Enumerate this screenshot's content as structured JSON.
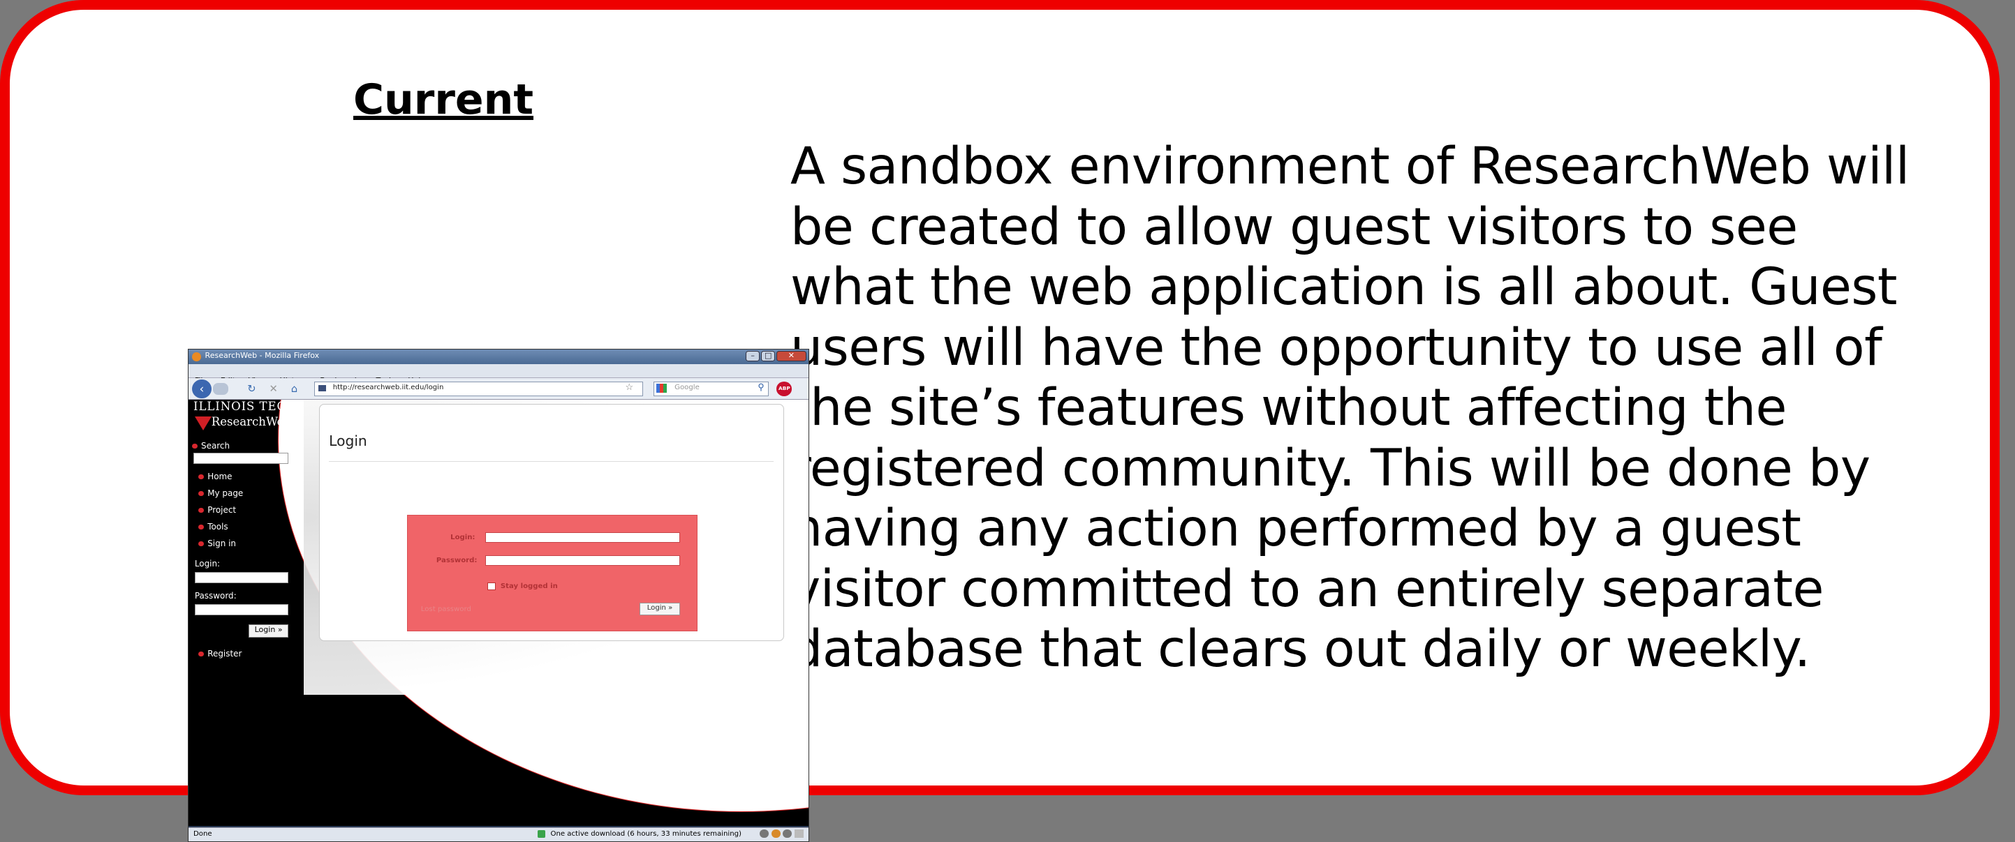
{
  "heading": "Current",
  "description_lines": [
    "A sandbox environment of ResearchWeb will",
    "be created to allow guest visitors to see",
    "what the web application is all about. Guest",
    "users will have the opportunity to use all of",
    "the site’s features without affecting the",
    "registered community. This will be done by",
    "having any action performed by a guest",
    "visitor committed to  an entirely separate",
    "database that clears out daily or weekly."
  ],
  "browser": {
    "window_title": "ResearchWeb - Mozilla Firefox",
    "menu": [
      "File",
      "Edit",
      "View",
      "History",
      "Bookmarks",
      "Tools",
      "Help"
    ],
    "url": "http://researchweb.iit.edu/login",
    "search_placeholder": "Google",
    "brand_line1": "ILLINOIS TECH",
    "brand_line2": "ResearchWeb",
    "sidebar": {
      "search_label": "Search",
      "nav": [
        "Home",
        "My page",
        "Project",
        "Tools",
        "Sign in"
      ],
      "login_label": "Login:",
      "password_label": "Password:",
      "login_button": "Login »",
      "register": "Register"
    },
    "panel": {
      "title": "Login",
      "login_label": "Login:",
      "password_label": "Password:",
      "stay_logged_in": "Stay logged in",
      "lost_password": "Lost password",
      "login_button": "Login »"
    },
    "status": {
      "left": "Done",
      "download": "One active download (6 hours, 33 minutes remaining)"
    }
  }
}
